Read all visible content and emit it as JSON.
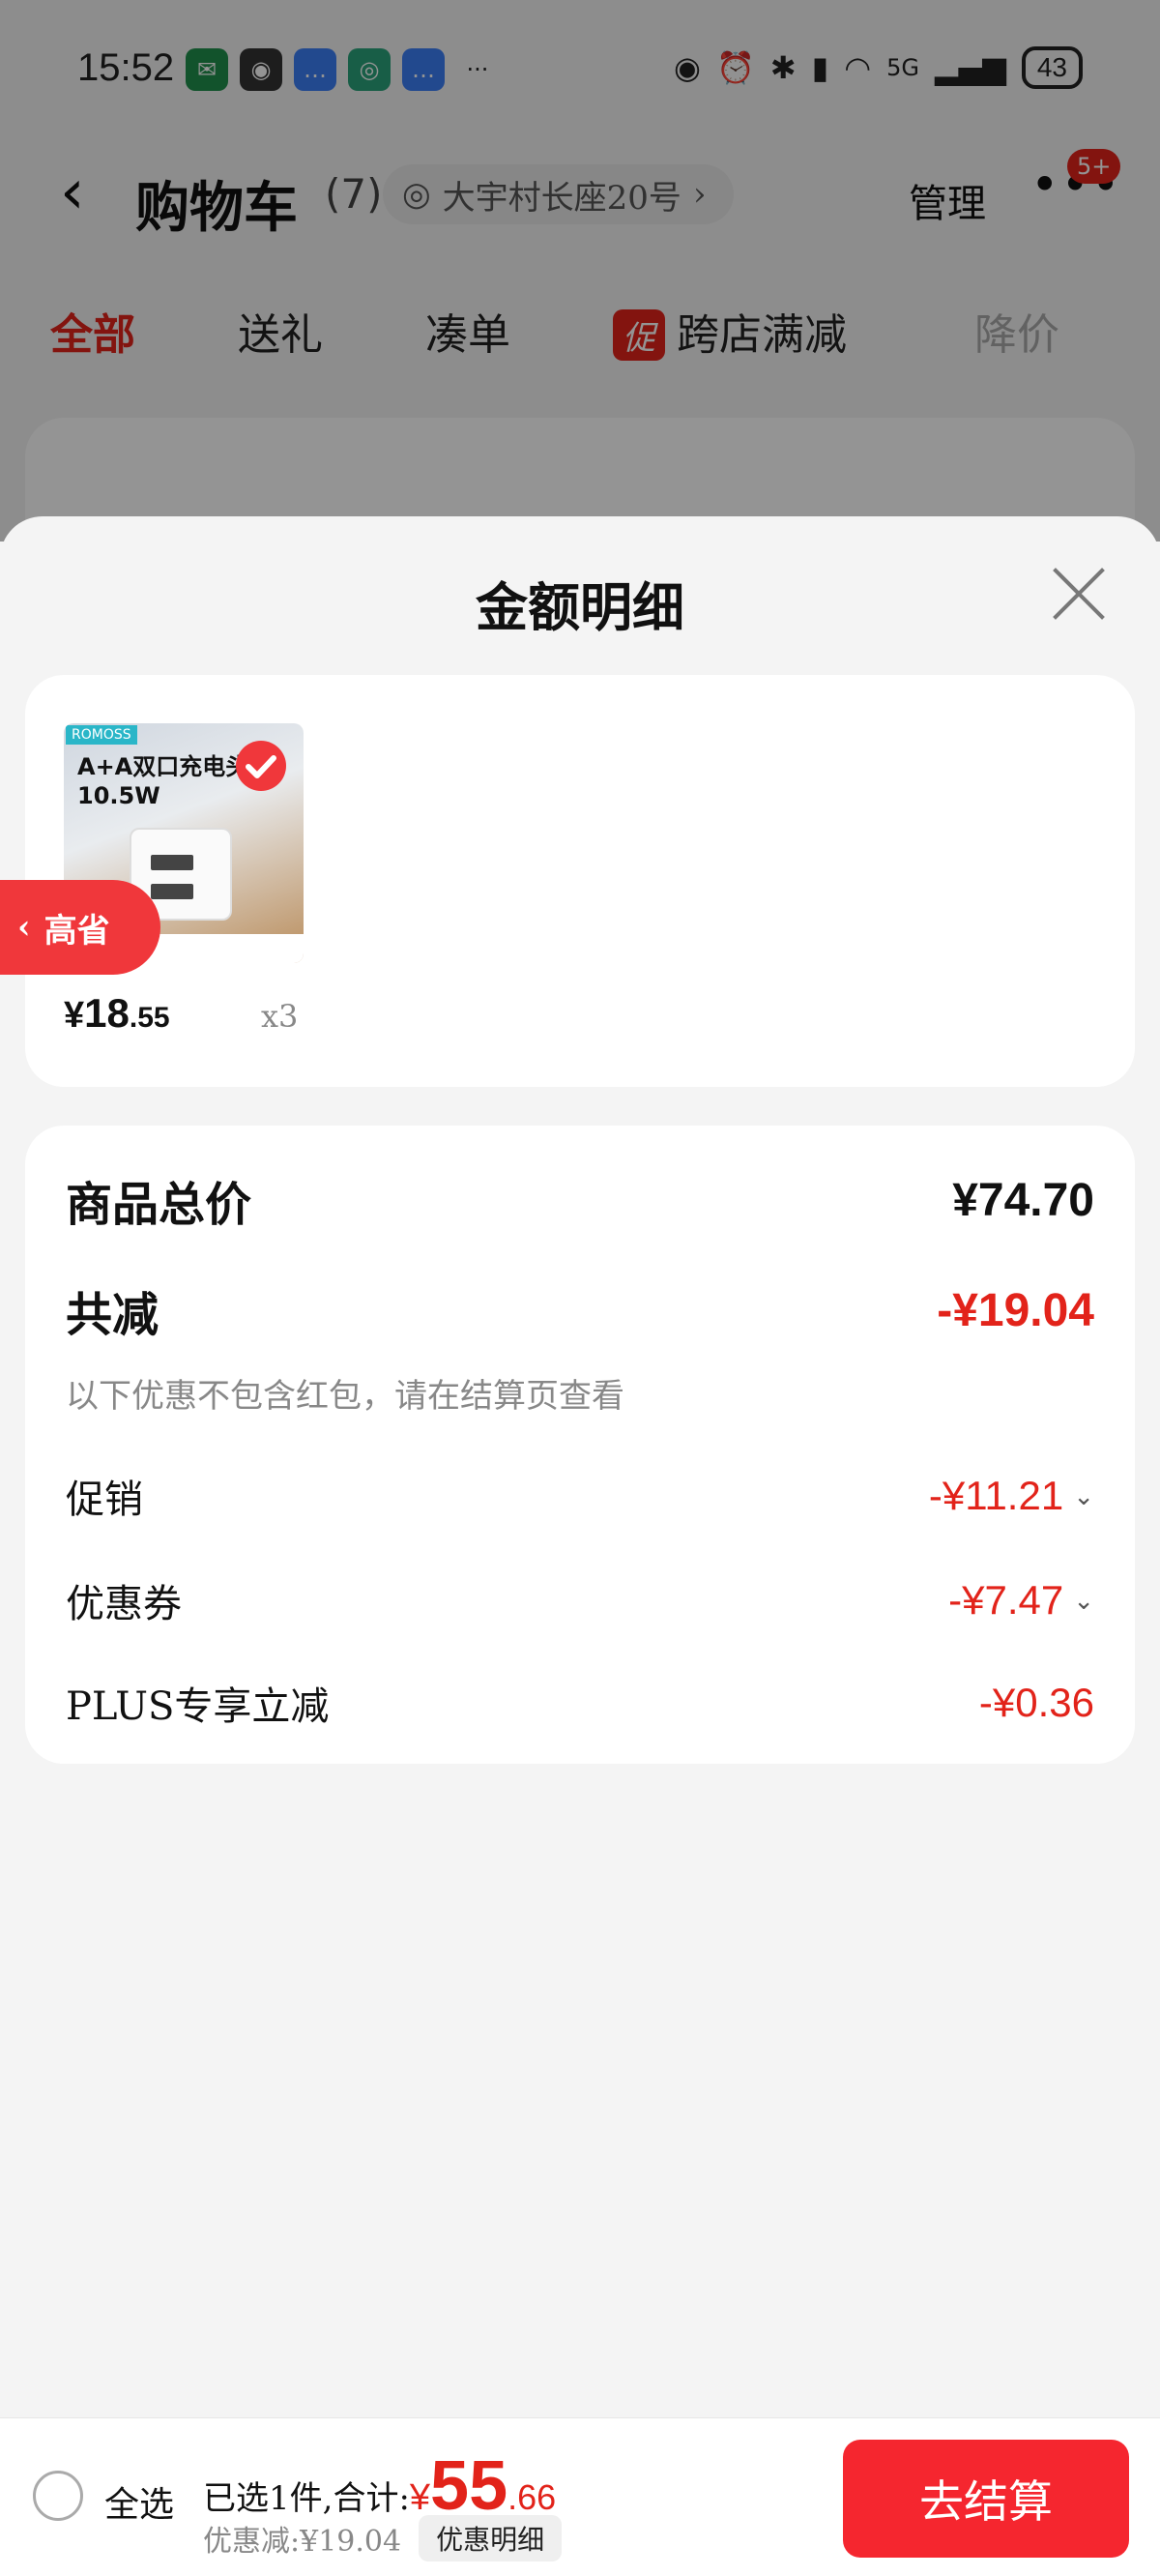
{
  "status_bar": {
    "time": "15:52",
    "network": "5G",
    "battery": "43"
  },
  "header": {
    "back_icon": "chevron-left-icon",
    "title": "购物车",
    "count": "(7)",
    "address": "大宇村长座20号",
    "manage": "管理",
    "more_badge": "5+"
  },
  "tabs": [
    {
      "label": "全部"
    },
    {
      "label": "送礼"
    },
    {
      "label": "凑单"
    },
    {
      "promo_tag": "促",
      "label": "跨店满减"
    },
    {
      "label": "降价"
    }
  ],
  "sheet": {
    "title": "金额明细",
    "item": {
      "image_title": "A+A双口充电头\n10.5W",
      "price_currency": "¥",
      "price_int": "18",
      "price_dec": ".55",
      "quantity": "x3"
    },
    "side_tag": "高省",
    "summary": {
      "total_label": "商品总价",
      "total_value": "¥74.70",
      "discount_label": "共减",
      "discount_value": "-¥19.04",
      "note": "以下优惠不包含红包，请在结算页查看",
      "promo_label": "促销",
      "promo_value": "-¥11.21",
      "coupon_label": "优惠券",
      "coupon_value": "-¥7.47",
      "plus_label": "PLUS专享立减",
      "plus_value": "-¥0.36"
    }
  },
  "bottom": {
    "select_all": "全选",
    "selected_label": "已选1件,合计:",
    "currency": "¥",
    "total_int": "55",
    "total_dec": ".66",
    "discount_text": "优惠减:¥19.04",
    "detail_button": "优惠明细",
    "checkout_button": "去结算"
  },
  "colors": {
    "accent_red": "#e2231a",
    "checkout_red": "#f5262f"
  }
}
